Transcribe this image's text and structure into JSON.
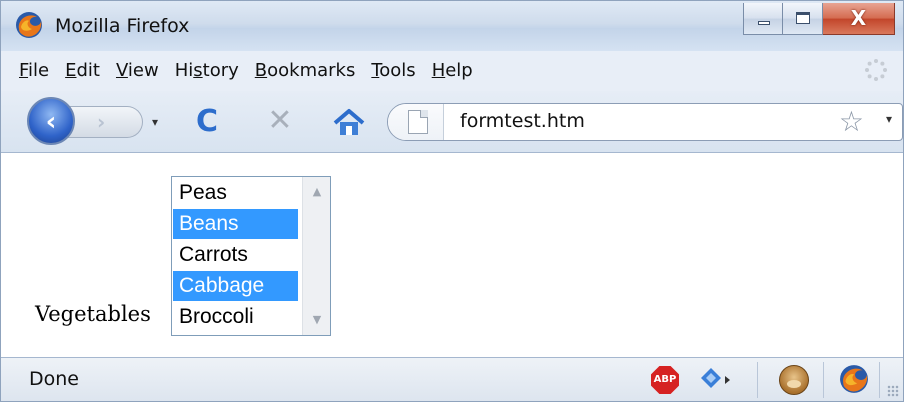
{
  "window": {
    "title": "Mozilla Firefox",
    "close_glyph": "X"
  },
  "menu": {
    "items": [
      {
        "pre": "",
        "u": "F",
        "post": "ile"
      },
      {
        "pre": "",
        "u": "E",
        "post": "dit"
      },
      {
        "pre": "",
        "u": "V",
        "post": "iew"
      },
      {
        "pre": "Hi",
        "u": "s",
        "post": "tory"
      },
      {
        "pre": "",
        "u": "B",
        "post": "ookmarks"
      },
      {
        "pre": "",
        "u": "T",
        "post": "ools"
      },
      {
        "pre": "",
        "u": "H",
        "post": "elp"
      }
    ]
  },
  "nav": {
    "back_glyph": "‹",
    "forward_glyph": "›",
    "dropdown_glyph": "▾",
    "reload_glyph": "C",
    "stop_glyph": "✕",
    "url": "formtest.htm",
    "star_glyph": "☆",
    "url_dropdown_glyph": "▾"
  },
  "form": {
    "label": "Vegetables",
    "options": [
      {
        "text": "Peas",
        "selected": false
      },
      {
        "text": "Beans",
        "selected": true
      },
      {
        "text": "Carrots",
        "selected": false
      },
      {
        "text": "Cabbage",
        "selected": true
      },
      {
        "text": "Broccoli",
        "selected": false
      }
    ],
    "scroll_up_glyph": "▲",
    "scroll_down_glyph": "▼"
  },
  "status": {
    "text": "Done",
    "abp_label": "ABP"
  },
  "colors": {
    "selection": "#3399ff",
    "titlebar": "#cfdcec",
    "close_button": "#c2452a"
  }
}
